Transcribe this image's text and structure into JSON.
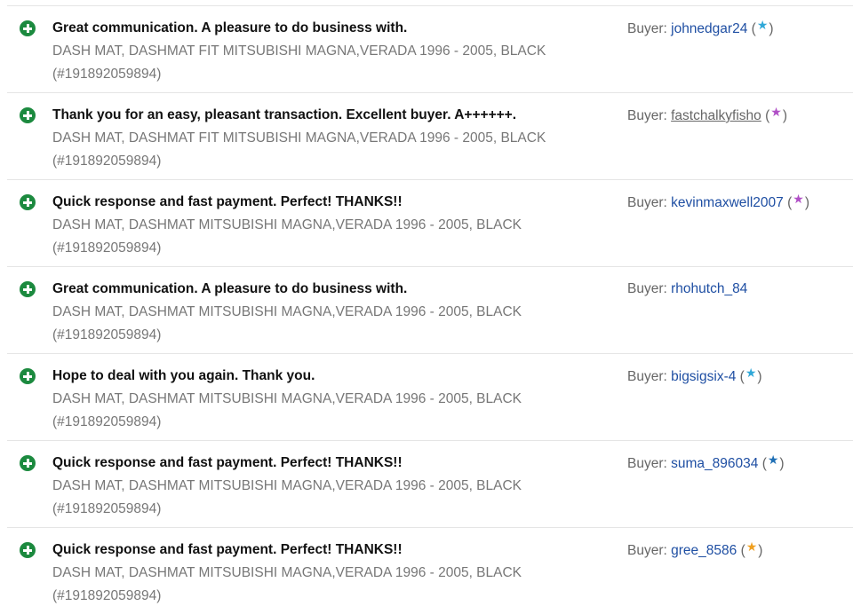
{
  "buyer_prefix": "Buyer:",
  "feedback": [
    {
      "comment": "Great communication. A pleasure to do business with.",
      "item": "DASH MAT, DASHMAT FIT MITSUBISHI MAGNA,VERADA 1996 - 2005, BLACK",
      "item_id": "(#191892059894)",
      "buyer": "johnedgar24",
      "paren_open": "(",
      "paren_close": ")",
      "star": "★",
      "star_color": "#30a8d8"
    },
    {
      "comment": "Thank you for an easy, pleasant transaction. Excellent buyer. A++++++.",
      "item": "DASH MAT, DASHMAT FIT MITSUBISHI MAGNA,VERADA 1996 - 2005, BLACK",
      "item_id": "(#191892059894)",
      "buyer": "fastchalkyfisho",
      "paren_open": "(",
      "paren_close": ")",
      "star": "★",
      "star_color": "#b04fc6"
    },
    {
      "comment": "Quick response and fast payment. Perfect! THANKS!!",
      "item": "DASH MAT, DASHMAT MITSUBISHI MAGNA,VERADA 1996 - 2005, BLACK",
      "item_id": "(#191892059894)",
      "buyer": "kevinmaxwell2007",
      "paren_open": "(",
      "paren_close": ")",
      "star": "★",
      "star_color": "#b04fc6"
    },
    {
      "comment": "Great communication. A pleasure to do business with.",
      "item": "DASH MAT, DASHMAT MITSUBISHI MAGNA,VERADA 1996 - 2005, BLACK",
      "item_id": "(#191892059894)",
      "buyer": "rhohutch_84",
      "paren_open": "",
      "paren_close": "",
      "star": "",
      "star_color": ""
    },
    {
      "comment": "Hope to deal with you again. Thank you.",
      "item": "DASH MAT, DASHMAT MITSUBISHI MAGNA,VERADA 1996 - 2005, BLACK",
      "item_id": "(#191892059894)",
      "buyer": "bigsigsix-4",
      "paren_open": "(",
      "paren_close": ")",
      "star": "★",
      "star_color": "#30a8d8"
    },
    {
      "comment": "Quick response and fast payment. Perfect! THANKS!!",
      "item": "DASH MAT, DASHMAT MITSUBISHI MAGNA,VERADA 1996 - 2005, BLACK",
      "item_id": "(#191892059894)",
      "buyer": "suma_896034",
      "paren_open": "(",
      "paren_close": ")",
      "star": "★",
      "star_color": "#1f6fb5"
    },
    {
      "comment": "Quick response and fast payment. Perfect! THANKS!!",
      "item": "DASH MAT, DASHMAT MITSUBISHI MAGNA,VERADA 1996 - 2005, BLACK",
      "item_id": "(#191892059894)",
      "buyer": "gree_8586",
      "paren_open": "(",
      "paren_close": ")",
      "star": "★",
      "star_color": "#f0a020"
    }
  ]
}
